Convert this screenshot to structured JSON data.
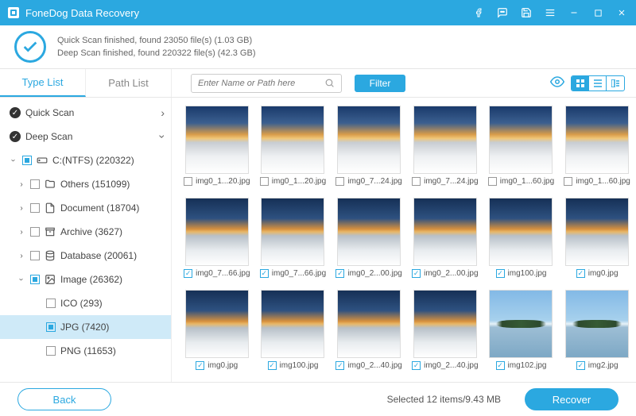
{
  "title": "FoneDog Data Recovery",
  "scan": {
    "quick": "Quick Scan finished, found 23050 file(s) (1.03 GB)",
    "deep": "Deep Scan finished, found 220322 file(s) (42.3 GB)"
  },
  "tabs": {
    "type": "Type List",
    "path": "Path List"
  },
  "search": {
    "placeholder": "Enter Name or Path here"
  },
  "filter": "Filter",
  "side": {
    "quick": "Quick Scan",
    "deep": "Deep Scan",
    "drive": "C:(NTFS) (220322)",
    "others": "Others (151099)",
    "document": "Document (18704)",
    "archive": "Archive (3627)",
    "database": "Database (20061)",
    "image": "Image (26362)",
    "ico": "ICO (293)",
    "jpg": "JPG (7420)",
    "png": "PNG (11653)"
  },
  "files": [
    {
      "name": "img0_1...20.jpg",
      "checked": false,
      "v": "sky"
    },
    {
      "name": "img0_1...20.jpg",
      "checked": false,
      "v": "sky"
    },
    {
      "name": "img0_7...24.jpg",
      "checked": false,
      "v": "sky"
    },
    {
      "name": "img0_7...24.jpg",
      "checked": false,
      "v": "sky"
    },
    {
      "name": "img0_1...60.jpg",
      "checked": false,
      "v": "sky"
    },
    {
      "name": "img0_1...60.jpg",
      "checked": false,
      "v": "sky"
    },
    {
      "name": "img0_7...66.jpg",
      "checked": true,
      "v": "sky2"
    },
    {
      "name": "img0_7...66.jpg",
      "checked": true,
      "v": "sky2"
    },
    {
      "name": "img0_2...00.jpg",
      "checked": true,
      "v": "sky2"
    },
    {
      "name": "img0_2...00.jpg",
      "checked": true,
      "v": "sky2"
    },
    {
      "name": "img100.jpg",
      "checked": true,
      "v": "sky2"
    },
    {
      "name": "img0.jpg",
      "checked": true,
      "v": "sky2"
    },
    {
      "name": "img0.jpg",
      "checked": true,
      "v": "sky2"
    },
    {
      "name": "img100.jpg",
      "checked": true,
      "v": "sky2"
    },
    {
      "name": "img0_2...40.jpg",
      "checked": true,
      "v": "sky2"
    },
    {
      "name": "img0_2...40.jpg",
      "checked": true,
      "v": "sky2"
    },
    {
      "name": "img102.jpg",
      "checked": true,
      "v": "island"
    },
    {
      "name": "img2.jpg",
      "checked": true,
      "v": "island"
    }
  ],
  "status": "Selected 12 items/9.43 MB",
  "buttons": {
    "back": "Back",
    "recover": "Recover"
  }
}
